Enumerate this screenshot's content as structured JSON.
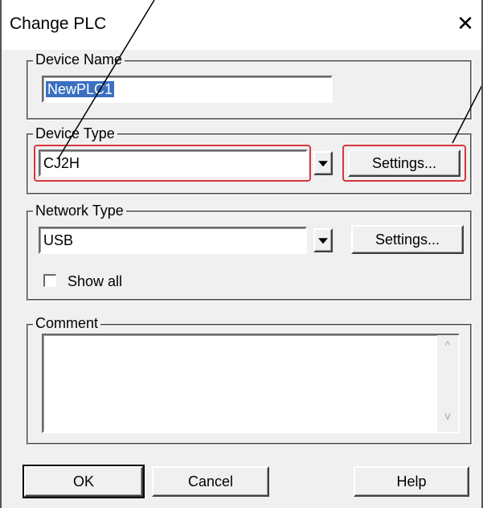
{
  "window": {
    "title": "Change PLC",
    "close_glyph": "✕"
  },
  "device_name": {
    "legend": "Device Name",
    "value": "NewPLC1"
  },
  "device_type": {
    "legend": "Device Type",
    "selected": "CJ2H",
    "settings_label": "Settings..."
  },
  "network_type": {
    "legend": "Network Type",
    "selected": "USB",
    "settings_label": "Settings...",
    "show_all_label": "Show all",
    "show_all_checked": false
  },
  "comment": {
    "legend": "Comment",
    "value": "",
    "scroll_up_glyph": "^",
    "scroll_down_glyph": "v"
  },
  "buttons": {
    "ok": "OK",
    "cancel": "Cancel",
    "help": "Help"
  },
  "colors": {
    "annotation": "#d9363e",
    "selection": "#3a6fc2",
    "dialog_bg": "#f0f0f0"
  }
}
